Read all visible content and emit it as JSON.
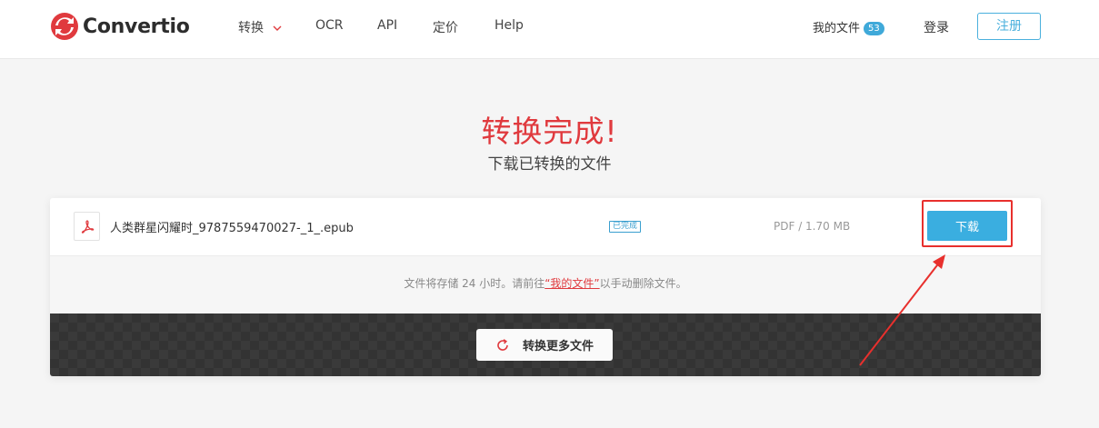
{
  "app": {
    "brand": "Convertio",
    "brand_color": "#e03a3e",
    "accent_color": "#3aaee0"
  },
  "nav": {
    "items": [
      {
        "label": "转换",
        "has_dropdown": true
      },
      {
        "label": "OCR"
      },
      {
        "label": "API"
      },
      {
        "label": "定价"
      },
      {
        "label": "Help"
      }
    ],
    "my_files_label": "我的文件",
    "my_files_count": "53",
    "login_label": "登录",
    "signup_label": "注册"
  },
  "main": {
    "title": "转换完成!",
    "subtitle": "下载已转换的文件"
  },
  "file": {
    "icon": "pdf-icon",
    "name": "人类群星闪耀时_9787559470027-_1_.epub",
    "status": "已完成",
    "meta": "PDF / 1.70 MB",
    "download_label": "下载"
  },
  "info": {
    "prefix": "文件将存储 24 小时。请前往",
    "link": "“我的文件”",
    "suffix": "以手动删除文件。"
  },
  "convert_more": {
    "icon": "refresh-icon",
    "label": "转换更多文件"
  }
}
